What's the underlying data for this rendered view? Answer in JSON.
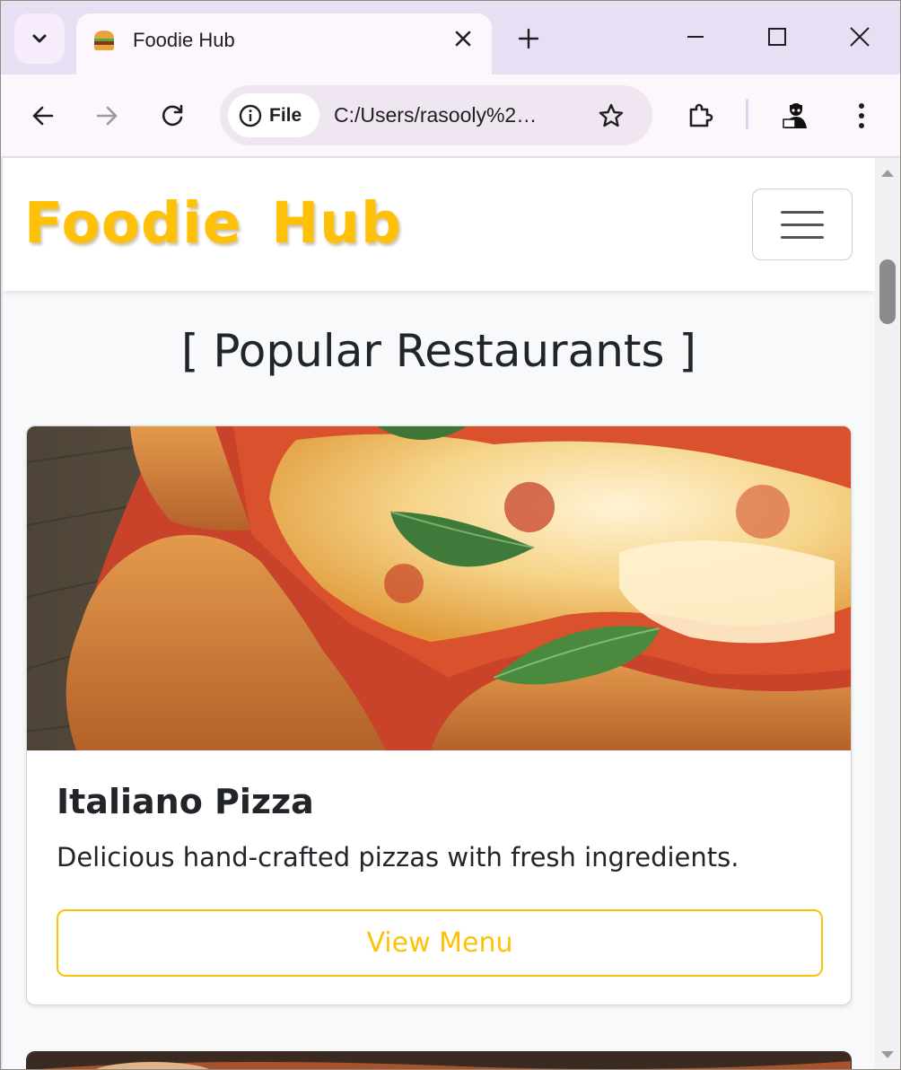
{
  "browser": {
    "tab_title": "Foodie Hub",
    "file_chip_label": "File",
    "url": "C:/Users/rasooly%2…",
    "icons": {
      "tab_search": "chevron-down-icon",
      "favicon": "burger-icon",
      "tab_close": "close-icon",
      "new_tab": "plus-icon",
      "minimize": "minimize-icon",
      "maximize": "maximize-icon",
      "close_window": "close-icon",
      "back": "arrow-left-icon",
      "forward": "arrow-right-icon",
      "reload": "reload-icon",
      "site_info": "info-icon",
      "bookmark": "star-icon",
      "extensions": "puzzle-icon",
      "profile": "avatar-icon",
      "menu": "kebab-menu-icon"
    }
  },
  "page": {
    "brand": "Foodie Hub",
    "brand_color": "#ffc107",
    "section_title": "[ Popular Restaurants ]",
    "cards": [
      {
        "title": "Italiano Pizza",
        "description": "Delicious hand-crafted pizzas with fresh ingredients.",
        "button_label": "View Menu"
      }
    ]
  }
}
